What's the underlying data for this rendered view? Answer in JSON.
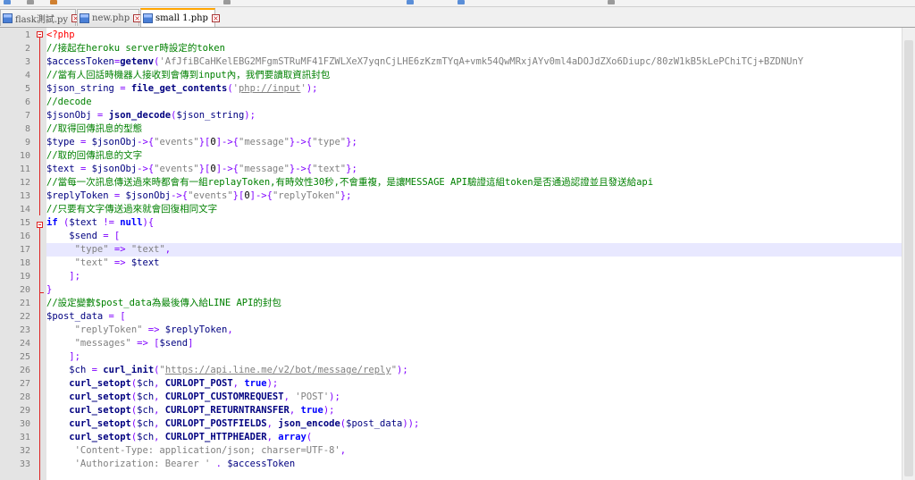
{
  "tabs": [
    {
      "label": "flask測試.py",
      "active": false
    },
    {
      "label": "new.php",
      "active": false
    },
    {
      "label": "small 1.php",
      "active": true
    }
  ],
  "editor": {
    "current_line": 17,
    "fold_markers": [
      1,
      15
    ],
    "lines": [
      {
        "n": "1",
        "t": [
          [
            "php",
            "<?php"
          ]
        ]
      },
      {
        "n": "2",
        "t": [
          [
            "cmt",
            "//接起在heroku server時設定的token"
          ]
        ]
      },
      {
        "n": "3",
        "t": [
          [
            "var",
            "$accessToken"
          ],
          [
            "op",
            "="
          ],
          [
            "fn",
            "getenv"
          ],
          [
            "op",
            "("
          ],
          [
            "str",
            "'AfJfiBCaHKelEBG2MFgmSTRuMF41FZWLXeX7yqnCjLHE6zKzmTYqA+vmk54QwMRxjAYv0ml4aDOJdZXo6Diupc/80zW1kB5kLePChiTCj+BZDNUnY"
          ]
        ]
      },
      {
        "n": "4",
        "t": [
          [
            "cmt",
            "//當有人回話時機器人接收到會傳到input內，我們要讀取資訊封包"
          ]
        ]
      },
      {
        "n": "5",
        "t": [
          [
            "var",
            "$json_string"
          ],
          [
            "",
            " "
          ],
          [
            "op",
            "="
          ],
          [
            "",
            " "
          ],
          [
            "fn",
            "file_get_contents"
          ],
          [
            "op",
            "("
          ],
          [
            "str",
            "'"
          ],
          [
            "link",
            "php://input"
          ],
          [
            "str",
            "'"
          ],
          [
            "op",
            ");"
          ]
        ]
      },
      {
        "n": "6",
        "t": [
          [
            "cmt",
            "//decode"
          ]
        ]
      },
      {
        "n": "7",
        "t": [
          [
            "var",
            "$jsonObj"
          ],
          [
            "",
            " "
          ],
          [
            "op",
            "="
          ],
          [
            "",
            " "
          ],
          [
            "fn",
            "json_decode"
          ],
          [
            "op",
            "("
          ],
          [
            "var",
            "$json_string"
          ],
          [
            "op",
            ");"
          ]
        ]
      },
      {
        "n": "8",
        "t": [
          [
            "cmt",
            "//取得回傳訊息的型態"
          ]
        ]
      },
      {
        "n": "9",
        "t": [
          [
            "var",
            "$type"
          ],
          [
            "",
            " "
          ],
          [
            "op",
            "="
          ],
          [
            "",
            " "
          ],
          [
            "var",
            "$jsonObj"
          ],
          [
            "op",
            "->{"
          ],
          [
            "str",
            "\"events\""
          ],
          [
            "op",
            "}["
          ],
          [
            "",
            "0"
          ],
          [
            "op",
            "]->{"
          ],
          [
            "str",
            "\"message\""
          ],
          [
            "op",
            "}->{"
          ],
          [
            "str",
            "\"type\""
          ],
          [
            "op",
            "};"
          ]
        ]
      },
      {
        "n": "10",
        "t": [
          [
            "cmt",
            "//取的回傳訊息的文字"
          ]
        ]
      },
      {
        "n": "11",
        "t": [
          [
            "var",
            "$text"
          ],
          [
            "",
            " "
          ],
          [
            "op",
            "="
          ],
          [
            "",
            " "
          ],
          [
            "var",
            "$jsonObj"
          ],
          [
            "op",
            "->{"
          ],
          [
            "str",
            "\"events\""
          ],
          [
            "op",
            "}["
          ],
          [
            "",
            "0"
          ],
          [
            "op",
            "]->{"
          ],
          [
            "str",
            "\"message\""
          ],
          [
            "op",
            "}->{"
          ],
          [
            "str",
            "\"text\""
          ],
          [
            "op",
            "};"
          ]
        ]
      },
      {
        "n": "12",
        "t": [
          [
            "cmt",
            "//當每一次訊息傳送過來時都會有一組replayToken,有時效性30秒,不會重複，是讓MESSAGE API驗證這組token是否通過認證並且發送給api"
          ]
        ]
      },
      {
        "n": "13",
        "t": [
          [
            "var",
            "$replyToken"
          ],
          [
            "",
            " "
          ],
          [
            "op",
            "="
          ],
          [
            "",
            " "
          ],
          [
            "var",
            "$jsonObj"
          ],
          [
            "op",
            "->{"
          ],
          [
            "str",
            "\"events\""
          ],
          [
            "op",
            "}["
          ],
          [
            "",
            "0"
          ],
          [
            "op",
            "]->{"
          ],
          [
            "str",
            "\"replyToken\""
          ],
          [
            "op",
            "};"
          ]
        ]
      },
      {
        "n": "14",
        "t": [
          [
            "cmt",
            "//只要有文字傳送過來就會回復相同文字"
          ]
        ]
      },
      {
        "n": "15",
        "t": [
          [
            "kw",
            "if"
          ],
          [
            "",
            " "
          ],
          [
            "op",
            "("
          ],
          [
            "var",
            "$text"
          ],
          [
            "",
            " "
          ],
          [
            "op",
            "!="
          ],
          [
            "",
            " "
          ],
          [
            "kw",
            "null"
          ],
          [
            "op",
            "){"
          ]
        ]
      },
      {
        "n": "16",
        "t": [
          [
            "",
            "    "
          ],
          [
            "var",
            "$send"
          ],
          [
            "",
            " "
          ],
          [
            "op",
            "="
          ],
          [
            "",
            " "
          ],
          [
            "op",
            "["
          ]
        ]
      },
      {
        "n": "17",
        "t": [
          [
            "",
            "     "
          ],
          [
            "str",
            "\"type\""
          ],
          [
            "",
            " "
          ],
          [
            "op",
            "=>"
          ],
          [
            "",
            " "
          ],
          [
            "str",
            "\"text\""
          ],
          [
            "op",
            ","
          ]
        ]
      },
      {
        "n": "18",
        "t": [
          [
            "",
            "     "
          ],
          [
            "str",
            "\"text\""
          ],
          [
            "",
            " "
          ],
          [
            "op",
            "=>"
          ],
          [
            "",
            " "
          ],
          [
            "var",
            "$text"
          ]
        ]
      },
      {
        "n": "19",
        "t": [
          [
            "",
            "    "
          ],
          [
            "op",
            "];"
          ]
        ]
      },
      {
        "n": "20",
        "t": [
          [
            "op",
            "}"
          ]
        ]
      },
      {
        "n": "21",
        "t": [
          [
            "cmt",
            "//設定變數$post_data為最後傳入給LINE API的封包"
          ]
        ]
      },
      {
        "n": "22",
        "t": [
          [
            "var",
            "$post_data"
          ],
          [
            "",
            " "
          ],
          [
            "op",
            "="
          ],
          [
            "",
            " "
          ],
          [
            "op",
            "["
          ]
        ]
      },
      {
        "n": "23",
        "t": [
          [
            "",
            "     "
          ],
          [
            "str",
            "\"replyToken\""
          ],
          [
            "",
            " "
          ],
          [
            "op",
            "=>"
          ],
          [
            "",
            " "
          ],
          [
            "var",
            "$replyToken"
          ],
          [
            "op",
            ","
          ]
        ]
      },
      {
        "n": "24",
        "t": [
          [
            "",
            "     "
          ],
          [
            "str",
            "\"messages\""
          ],
          [
            "",
            " "
          ],
          [
            "op",
            "=>"
          ],
          [
            "",
            " "
          ],
          [
            "op",
            "["
          ],
          [
            "var",
            "$send"
          ],
          [
            "op",
            "]"
          ]
        ]
      },
      {
        "n": "25",
        "t": [
          [
            "",
            "    "
          ],
          [
            "op",
            "];"
          ]
        ]
      },
      {
        "n": "26",
        "t": [
          [
            "",
            "    "
          ],
          [
            "var",
            "$ch"
          ],
          [
            "",
            " "
          ],
          [
            "op",
            "="
          ],
          [
            "",
            " "
          ],
          [
            "fn",
            "curl_init"
          ],
          [
            "op",
            "("
          ],
          [
            "str",
            "\""
          ],
          [
            "link",
            "https://api.line.me/v2/bot/message/reply"
          ],
          [
            "str",
            "\""
          ],
          [
            "op",
            ");"
          ]
        ]
      },
      {
        "n": "27",
        "t": [
          [
            "",
            "    "
          ],
          [
            "fn",
            "curl_setopt"
          ],
          [
            "op",
            "("
          ],
          [
            "var",
            "$ch"
          ],
          [
            "op",
            ","
          ],
          [
            "",
            " "
          ],
          [
            "cst",
            "CURLOPT_POST"
          ],
          [
            "op",
            ","
          ],
          [
            "",
            " "
          ],
          [
            "kw",
            "true"
          ],
          [
            "op",
            ");"
          ]
        ]
      },
      {
        "n": "28",
        "t": [
          [
            "",
            "    "
          ],
          [
            "fn",
            "curl_setopt"
          ],
          [
            "op",
            "("
          ],
          [
            "var",
            "$ch"
          ],
          [
            "op",
            ","
          ],
          [
            "",
            " "
          ],
          [
            "cst",
            "CURLOPT_CUSTOMREQUEST"
          ],
          [
            "op",
            ","
          ],
          [
            "",
            " "
          ],
          [
            "str",
            "'POST'"
          ],
          [
            "op",
            ");"
          ]
        ]
      },
      {
        "n": "29",
        "t": [
          [
            "",
            "    "
          ],
          [
            "fn",
            "curl_setopt"
          ],
          [
            "op",
            "("
          ],
          [
            "var",
            "$ch"
          ],
          [
            "op",
            ","
          ],
          [
            "",
            " "
          ],
          [
            "cst",
            "CURLOPT_RETURNTRANSFER"
          ],
          [
            "op",
            ","
          ],
          [
            "",
            " "
          ],
          [
            "kw",
            "true"
          ],
          [
            "op",
            ");"
          ]
        ]
      },
      {
        "n": "30",
        "t": [
          [
            "",
            "    "
          ],
          [
            "fn",
            "curl_setopt"
          ],
          [
            "op",
            "("
          ],
          [
            "var",
            "$ch"
          ],
          [
            "op",
            ","
          ],
          [
            "",
            " "
          ],
          [
            "cst",
            "CURLOPT_POSTFIELDS"
          ],
          [
            "op",
            ","
          ],
          [
            "",
            " "
          ],
          [
            "fn",
            "json_encode"
          ],
          [
            "op",
            "("
          ],
          [
            "var",
            "$post_data"
          ],
          [
            "op",
            "));"
          ]
        ]
      },
      {
        "n": "31",
        "t": [
          [
            "",
            "    "
          ],
          [
            "fn",
            "curl_setopt"
          ],
          [
            "op",
            "("
          ],
          [
            "var",
            "$ch"
          ],
          [
            "op",
            ","
          ],
          [
            "",
            " "
          ],
          [
            "cst",
            "CURLOPT_HTTPHEADER"
          ],
          [
            "op",
            ","
          ],
          [
            "",
            " "
          ],
          [
            "kw",
            "array"
          ],
          [
            "op",
            "("
          ]
        ]
      },
      {
        "n": "32",
        "t": [
          [
            "",
            "     "
          ],
          [
            "str",
            "'Content-Type: application/json; charser=UTF-8'"
          ],
          [
            "op",
            ","
          ]
        ]
      },
      {
        "n": "33",
        "t": [
          [
            "",
            "     "
          ],
          [
            "str",
            "'Authorization: Bearer '"
          ],
          [
            "",
            " "
          ],
          [
            "op",
            "."
          ],
          [
            "",
            " "
          ],
          [
            "var",
            "$accessToken"
          ]
        ]
      }
    ]
  }
}
